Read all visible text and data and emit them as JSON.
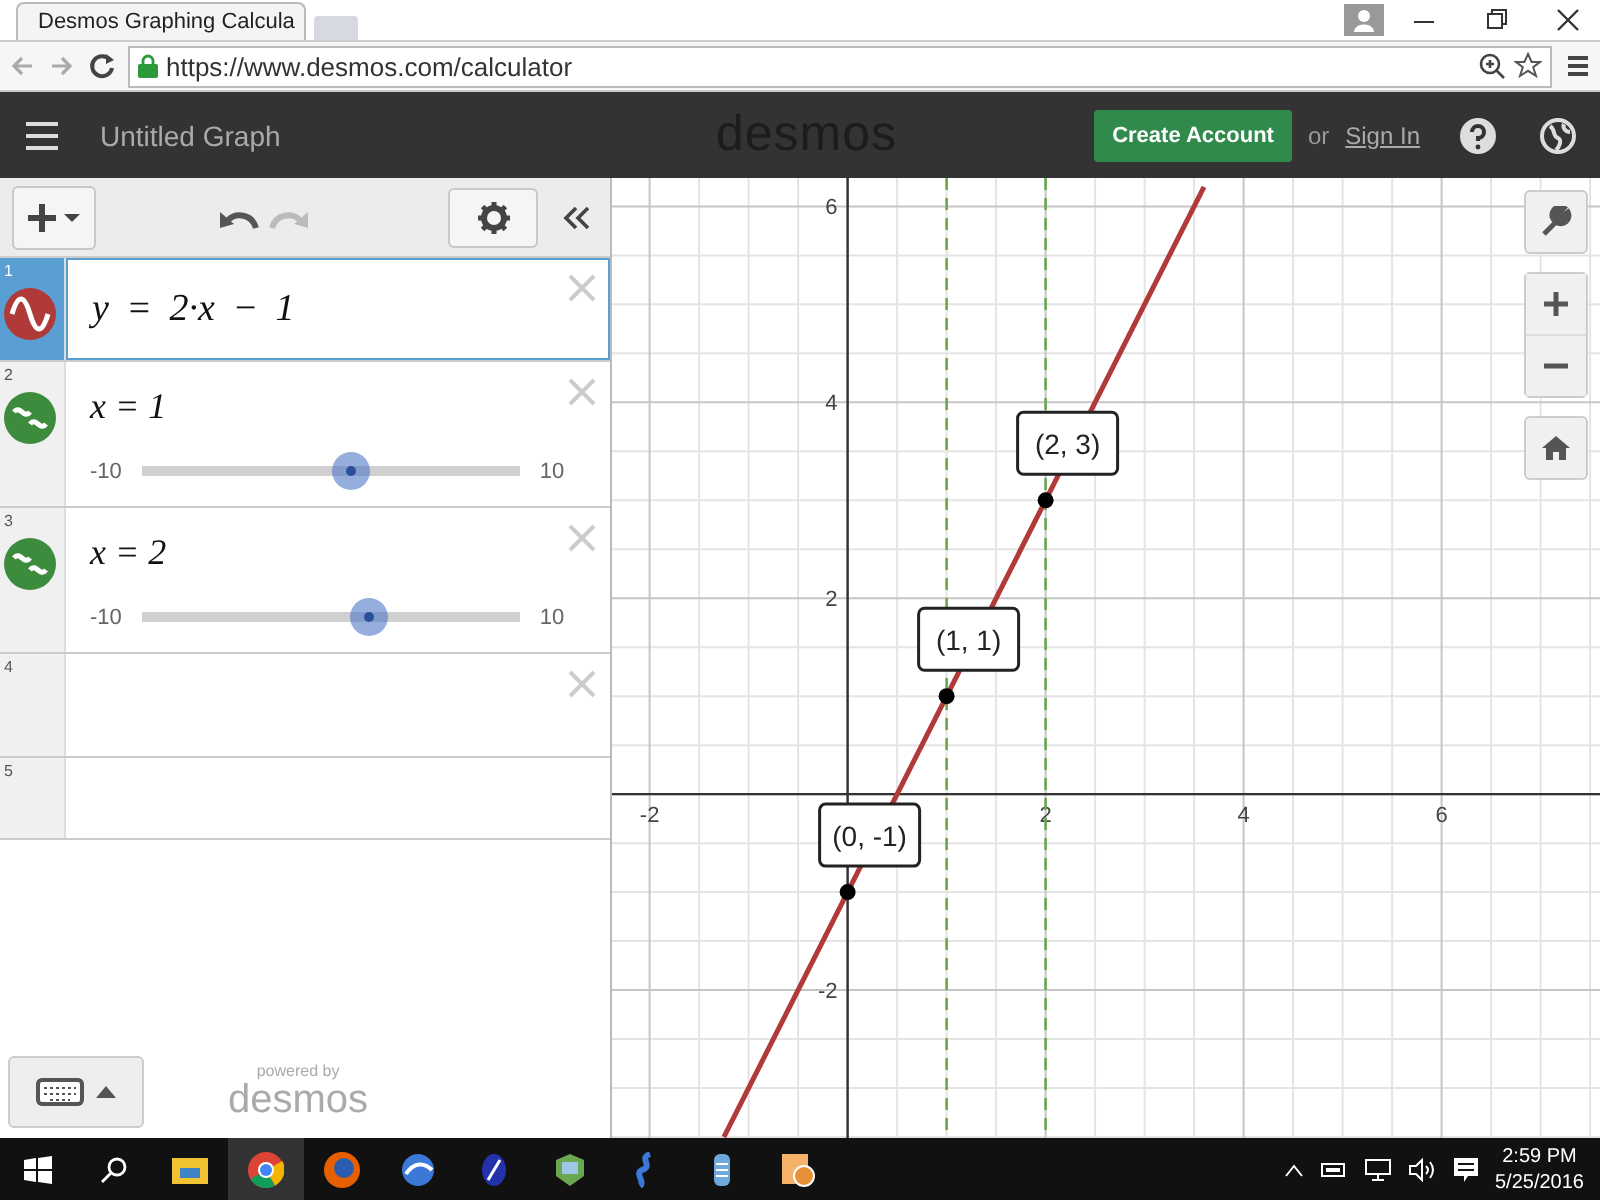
{
  "browser": {
    "tab_title": "Desmos Graphing Calcula",
    "url": "https://www.desmos.com/calculator"
  },
  "header": {
    "title": "Untitled Graph",
    "logo": "desmos",
    "create_account": "Create Account",
    "or_text": "or",
    "sign_in": "Sign In"
  },
  "expressions": [
    {
      "number": "1",
      "kind": "equation",
      "text": "y = 2·x − 1",
      "color": "#b03a37",
      "selected": true
    },
    {
      "number": "2",
      "kind": "slider",
      "text": "x = 1",
      "color": "#3d8b3d",
      "selected": false,
      "min": "-10",
      "max": "10",
      "level": 0.55
    },
    {
      "number": "3",
      "kind": "slider",
      "text": "x = 2",
      "color": "#3d8b3d",
      "selected": false,
      "min": "-10",
      "max": "10",
      "level": 0.6
    },
    {
      "number": "4",
      "kind": "empty",
      "selected": false
    },
    {
      "number": "5",
      "kind": "new",
      "selected": false
    }
  ],
  "footer": {
    "powered_by": "powered by",
    "logo": "desmos"
  },
  "graph": {
    "chart_data": {
      "type": "line",
      "x": [
        -1.25,
        3.6
      ],
      "series": [
        {
          "color": "#b03a37",
          "values": [
            -3.5,
            6.2
          ]
        }
      ],
      "xlim": [
        -2.38,
        7.6
      ],
      "ylim": [
        -3.51,
        6.29
      ],
      "xticks": [
        -2,
        2,
        4,
        6
      ],
      "yticks": [
        -2,
        2,
        4,
        6
      ],
      "grid": true,
      "ref_lines": [
        {
          "axis": "x",
          "value": 1,
          "color": "#6aa84f"
        },
        {
          "axis": "x",
          "value": 2,
          "color": "#6aa84f"
        }
      ],
      "annotations": [
        {
          "x": 0,
          "y": -1,
          "text": "(0, -1)"
        },
        {
          "x": 1,
          "y": 1,
          "text": "(1, 1)"
        },
        {
          "x": 2,
          "y": 3,
          "text": "(2, 3)"
        }
      ]
    }
  },
  "taskbar": {
    "time": "2:59 PM",
    "date": "5/25/2016"
  }
}
